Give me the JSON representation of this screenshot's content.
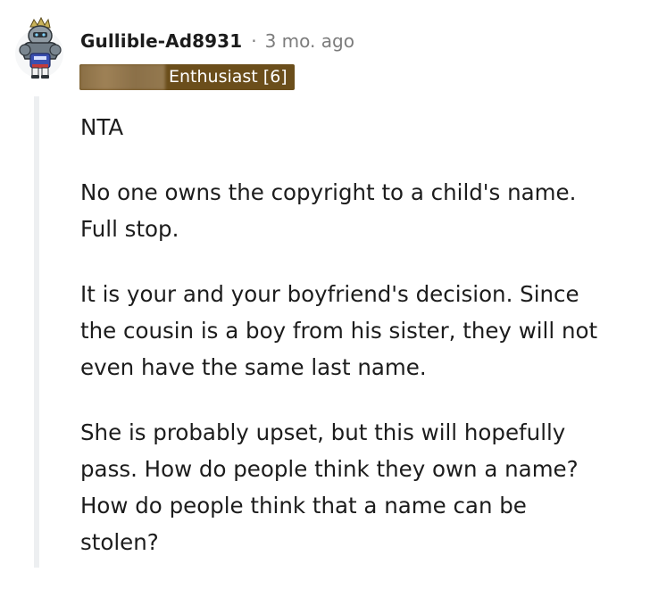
{
  "comment": {
    "username": "Gullible-Ad8931",
    "separator": "·",
    "timestamp": "3 mo. ago",
    "flair": {
      "text": "Enthusiast [6]",
      "background": "#6b4e1b"
    },
    "paragraphs": [
      [
        "NTA"
      ],
      [
        "No one owns the copyright to a child's name.",
        "Full stop."
      ],
      [
        "It is your and your boyfriend's decision. Since",
        "the cousin is a boy from his sister, they will not",
        "even have the same last name."
      ],
      [
        "She is probably upset, but this will hopefully",
        "pass. How do people think they own a name?",
        "How do people think that a name can be",
        "stolen?"
      ]
    ]
  },
  "colors": {
    "text": "#1c1c1c",
    "muted": "#7c7c7c",
    "thread_line": "#edeff1",
    "flair_bg": "#6b4e1b"
  },
  "icons": {
    "avatar": "snoo-robot-avatar-icon"
  }
}
